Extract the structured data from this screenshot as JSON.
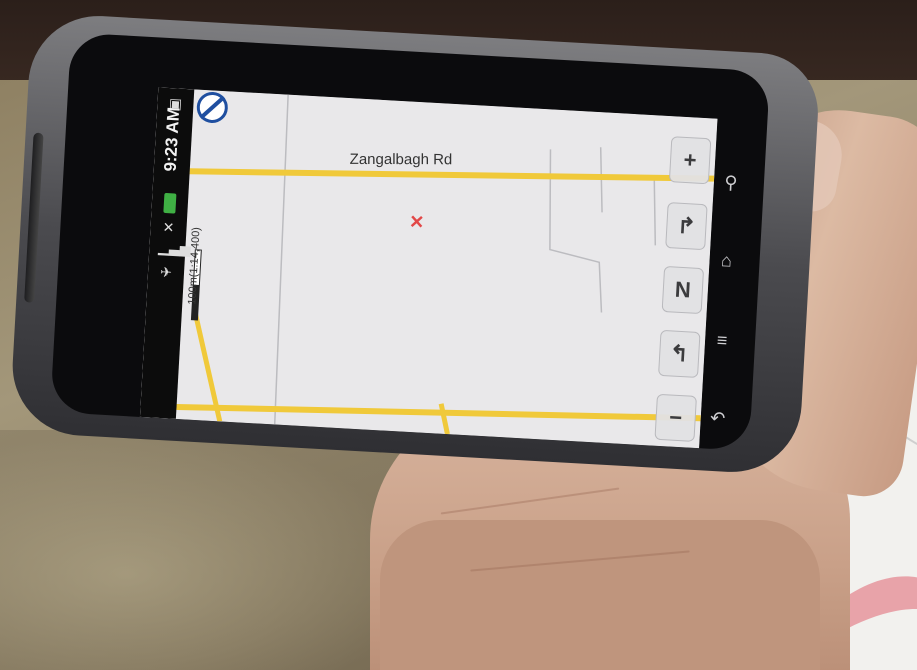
{
  "map": {
    "road_label": "Zangalbagh Rd",
    "scale_label": "100m(1:14,400)",
    "crosshair_glyph": "✕"
  },
  "status_bar": {
    "time": "9:23 AM"
  },
  "map_controls": {
    "zoom_in": "+",
    "zoom_out": "−",
    "compass": "N",
    "forward": "↱",
    "back": "↰"
  },
  "hardware_buttons": [
    "search-icon",
    "home-icon",
    "menu-icon",
    "back-icon"
  ],
  "colors": {
    "road": "#f0c93a",
    "map_bg": "#e9e8ea",
    "marker": "#e24848",
    "battery": "#3fb044"
  }
}
